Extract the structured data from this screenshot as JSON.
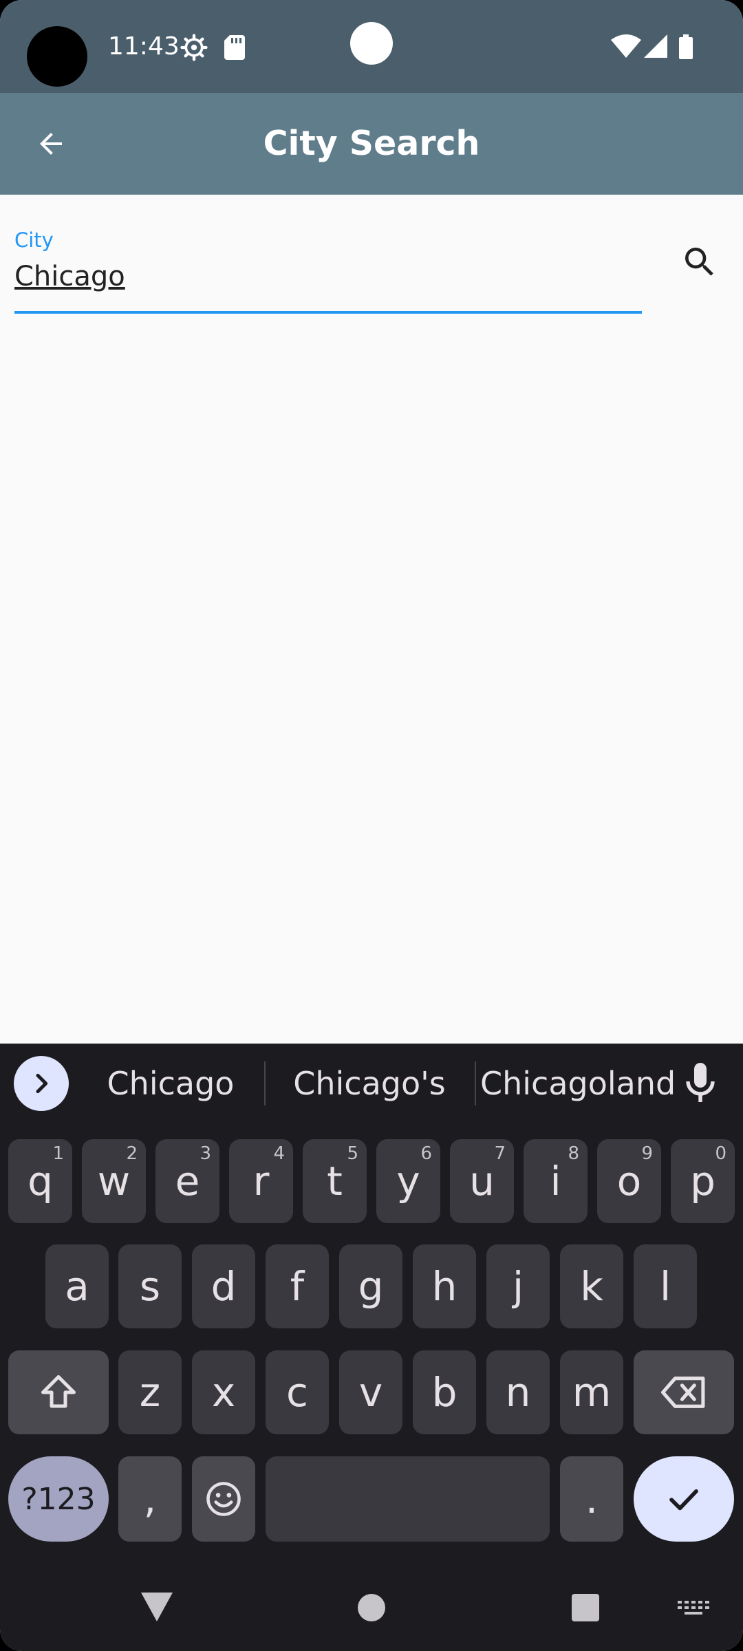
{
  "status_bar": {
    "time": "11:43"
  },
  "app_bar": {
    "title": "City Search"
  },
  "form": {
    "city_label": "City",
    "city_value": "Chicago"
  },
  "keyboard": {
    "suggestions": [
      "Chicago",
      "Chicago's",
      "Chicagoland"
    ],
    "row1": [
      "q",
      "w",
      "e",
      "r",
      "t",
      "y",
      "u",
      "i",
      "o",
      "p"
    ],
    "row1_hints": [
      "1",
      "2",
      "3",
      "4",
      "5",
      "6",
      "7",
      "8",
      "9",
      "0"
    ],
    "row2": [
      "a",
      "s",
      "d",
      "f",
      "g",
      "h",
      "j",
      "k",
      "l"
    ],
    "row3": [
      "z",
      "x",
      "c",
      "v",
      "b",
      "n",
      "m"
    ],
    "symbols_key": "?123",
    "comma_key": ",",
    "period_key": "."
  },
  "colors": {
    "status_bar": "#4a5f6b",
    "app_bar": "#607d8b",
    "accent": "#2196f3",
    "keyboard_bg": "#1c1b1f"
  }
}
